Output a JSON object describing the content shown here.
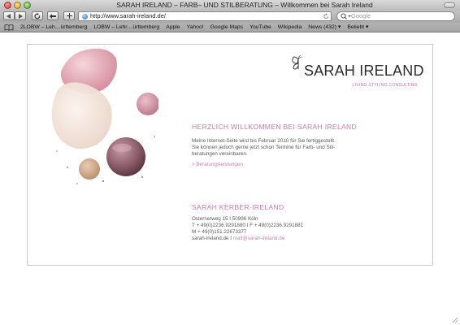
{
  "browser": {
    "window_title": "SARAH IRELAND – FARB– UND STILBERATUNG – Willkommen bei Sarah Ireland",
    "url": "http://www.sarah-ireland.de/",
    "search_placeholder": "Google",
    "bookmarks": [
      "2LOBW – Leh…ürttemberg",
      "LOBW – Lehr…ürttemberg",
      "Apple",
      "Yahoo!",
      "Google Maps",
      "YouTube",
      "Wikipedia",
      "News (432) ▾",
      "Beliebt ▾"
    ]
  },
  "page": {
    "logo": {
      "name": "SARAH IRELAND",
      "tagline": "LIVING.STYLING.CONSULTING"
    },
    "welcome": {
      "heading": "HERZLICH WILLKOMMEN BEI SARAH IRELAND",
      "lines": [
        "Meine Internet-Seite wird bis Februar 2010 für Sie fertiggestellt.",
        "Sie können jedoch gerne jetzt schon Termine für Farb- und Stil-",
        "beratungen vereinbaren."
      ],
      "link": "> Beratungsleistungen"
    },
    "contact": {
      "heading": "SARAH KERBER-IRELAND",
      "address": "Osternetweg 15 I 50996 Köln",
      "phone": "T + 49(0)2236.9291880 I F + 49(0)2236.9291881",
      "mobile": "M + 49(0)151.22673377",
      "website": "sarah-ireland.de I",
      "email": "mail@sarah-ireland.de"
    }
  }
}
